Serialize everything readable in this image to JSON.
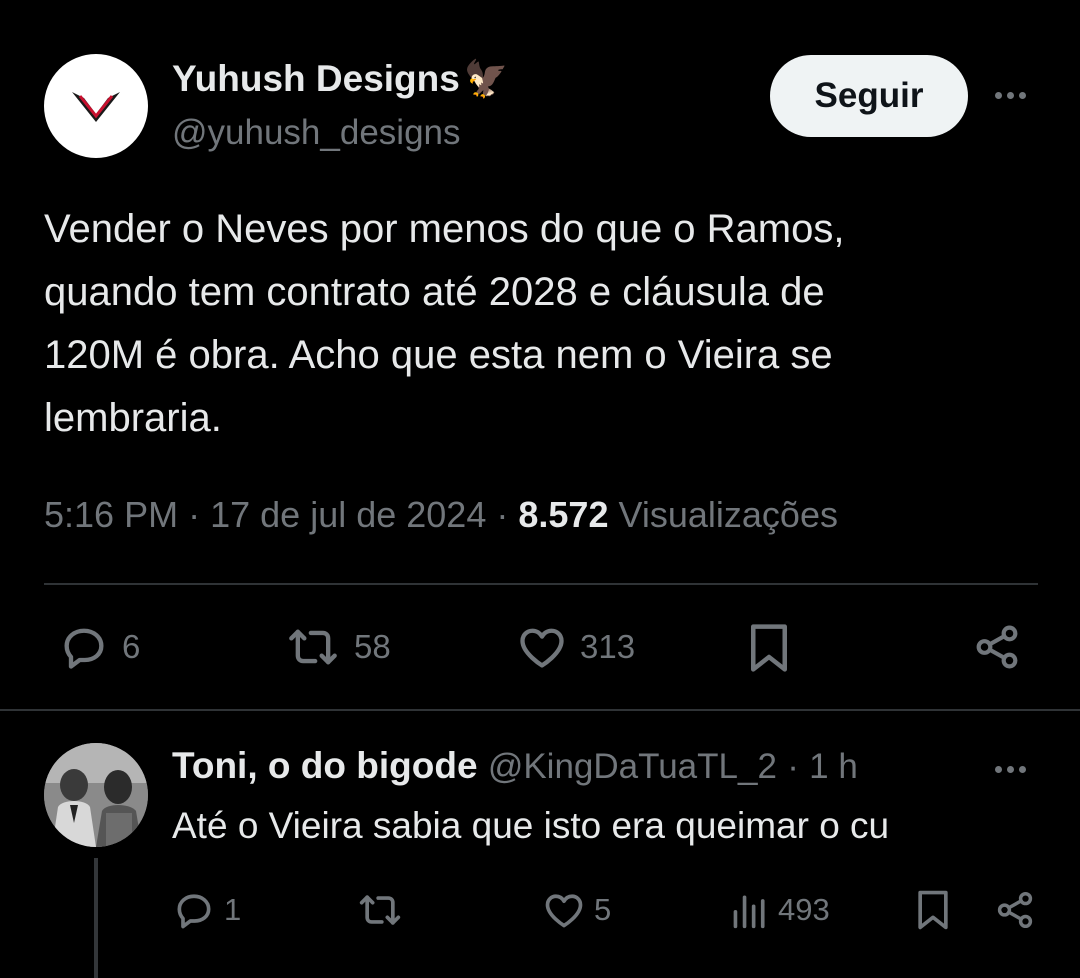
{
  "tweet": {
    "author_name": "Yuhush Designs",
    "author_emoji": "🦅",
    "author_handle": "@yuhush_designs",
    "follow_label": "Seguir",
    "text_lines": [
      "Vender o Neves por menos do que o Ramos,",
      "quando tem contrato até 2028 e cláusula de",
      "120M é obra. Acho que esta nem o Vieira se",
      "lembraria."
    ],
    "time": "5:16 PM",
    "date": "17 de jul de 2024",
    "separator": "·",
    "views_count": "8.572",
    "views_label": "Visualizações",
    "stats": {
      "replies": "6",
      "retweets": "58",
      "likes": "313"
    }
  },
  "reply": {
    "author_name": "Toni, o do bigode",
    "author_handle": "@KingDaTuaTL_2",
    "separator": "·",
    "time": "1 h",
    "text": "Até o Vieira sabia que isto era queimar o cu",
    "stats": {
      "replies": "1",
      "likes": "5",
      "views": "493"
    }
  },
  "colors": {
    "background": "#000000",
    "text_primary": "#e7e9ea",
    "text_secondary": "#71767b",
    "divider": "#2f3336",
    "follow_button_bg": "#eff3f4"
  },
  "icons": [
    "reply-icon",
    "retweet-icon",
    "like-icon",
    "bookmark-icon",
    "share-icon",
    "views-icon",
    "more-icon"
  ]
}
